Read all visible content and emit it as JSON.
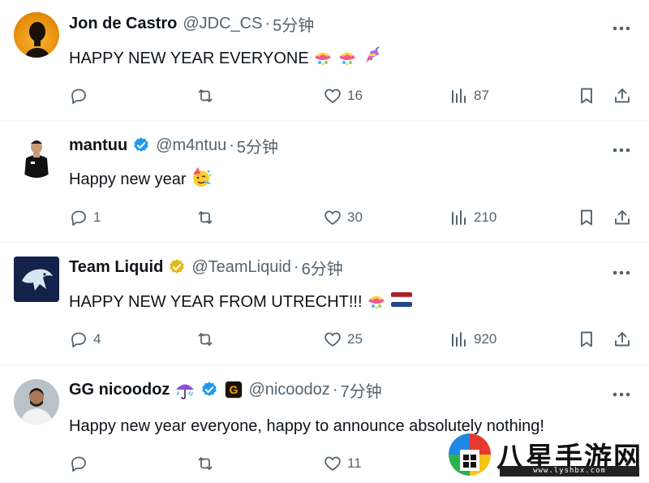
{
  "tweets": [
    {
      "name": "Jon de Castro",
      "verified": false,
      "handle": "@JDC_CS",
      "separator": "·",
      "time": "5分钟",
      "text": "HAPPY NEW YEAR EVERYONE",
      "emojis": [
        "pinata-emoji",
        "pinata-emoji",
        "pinata-emoji"
      ],
      "replies": "",
      "reposts": "",
      "likes": "16",
      "views": "87"
    },
    {
      "name": "mantuu",
      "verified": true,
      "handle": "@m4ntuu",
      "separator": "·",
      "time": "5分钟",
      "text": "Happy new year",
      "emojis": [
        "partying-face-emoji"
      ],
      "replies": "1",
      "reposts": "",
      "likes": "30",
      "views": "210"
    },
    {
      "name": "Team Liquid",
      "verified": true,
      "verified_color": "gold",
      "handle": "@TeamLiquid",
      "separator": "·",
      "time": "6分钟",
      "text": "HAPPY NEW YEAR FROM UTRECHT!!!",
      "emojis": [
        "pinata-emoji",
        "netherlands-flag-emoji"
      ],
      "replies": "4",
      "reposts": "",
      "likes": "25",
      "views": "920"
    },
    {
      "name": "GG nicoodoz",
      "verified": true,
      "handle": "@nicoodoz",
      "separator": "·",
      "time": "7分钟",
      "text": "Happy new year everyone, happy to announce absolutely nothing!",
      "emojis": [],
      "replies": "",
      "reposts": "",
      "likes": "11",
      "views": ""
    }
  ],
  "watermark": {
    "title": "八星手游网",
    "url": "www.lyshbx.com"
  },
  "colors": {
    "text": "#0f1419",
    "secondary": "#536471",
    "verified_blue": "#1d9bf0",
    "verified_gold": "#e2b719",
    "divider": "#eff3f4"
  }
}
